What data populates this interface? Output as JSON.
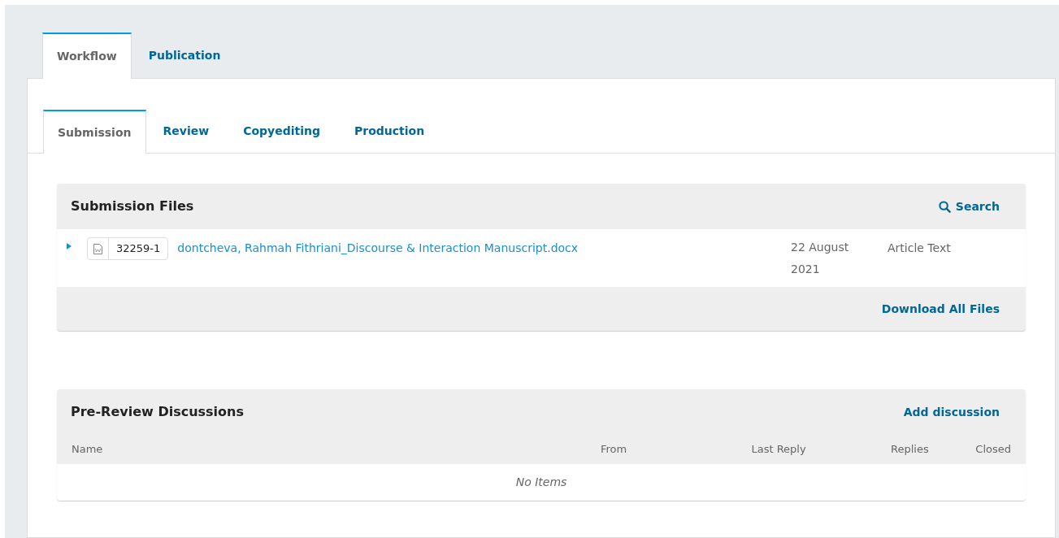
{
  "main_tabs": [
    {
      "label": "Workflow",
      "selected": true
    },
    {
      "label": "Publication",
      "selected": false
    }
  ],
  "stage_tabs": [
    {
      "label": "Submission",
      "selected": true
    },
    {
      "label": "Review",
      "selected": false
    },
    {
      "label": "Copyediting",
      "selected": false
    },
    {
      "label": "Production",
      "selected": false
    }
  ],
  "submission_files": {
    "title": "Submission Files",
    "search_label": "Search",
    "files": [
      {
        "id": "32259-1",
        "name": "dontcheva, Rahmah Fithriani_Discourse & Interaction Manuscript.docx",
        "date": "22 August 2021",
        "component": "Article Text"
      }
    ],
    "footer_action": "Download All Files"
  },
  "discussions": {
    "title": "Pre-Review Discussions",
    "action": "Add discussion",
    "columns": [
      "Name",
      "From",
      "Last Reply",
      "Replies",
      "Closed"
    ],
    "empty_text": "No Items"
  }
}
